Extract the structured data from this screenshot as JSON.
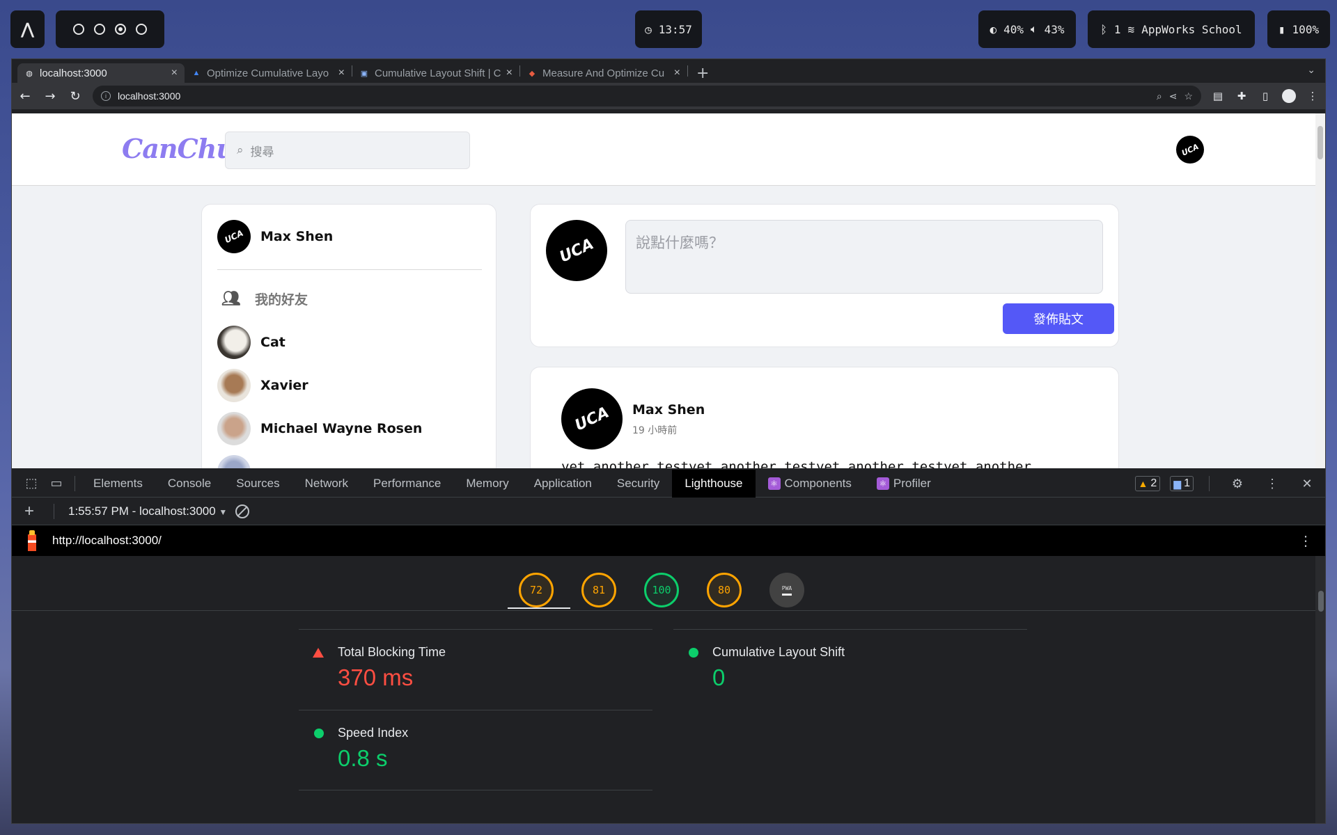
{
  "topbar": {
    "clock": "13:57",
    "brightness": "40%",
    "volume": "43%",
    "bluetooth_count": "1",
    "wifi_name": "AppWorks School",
    "battery": "100%"
  },
  "browser": {
    "tabs": [
      {
        "title": "localhost:3000",
        "icon": "globe-icon",
        "active": true
      },
      {
        "title": "Optimize Cumulative Layo",
        "icon": "web-dev-icon",
        "active": false
      },
      {
        "title": "Cumulative Layout Shift | C",
        "icon": "chrome-devs-icon",
        "active": false
      },
      {
        "title": "Measure And Optimize Cu",
        "icon": "smashing-icon",
        "active": false
      }
    ],
    "address": "localhost:3000"
  },
  "page": {
    "logo": "CanChu",
    "search_placeholder": "搜尋",
    "me_name": "Max Shen",
    "friends_title": "我的好友",
    "friends": [
      {
        "name": "Cat"
      },
      {
        "name": "Xavier"
      },
      {
        "name": "Michael Wayne Rosen"
      }
    ],
    "composer_placeholder": "說點什麼嗎？",
    "post_button": "發佈貼文",
    "post": {
      "author": "Max Shen",
      "time": "19 小時前",
      "body": "yet another testyet another testyet another testyet another"
    }
  },
  "devtools": {
    "tabs": [
      "Elements",
      "Console",
      "Sources",
      "Network",
      "Performance",
      "Memory",
      "Application",
      "Security",
      "Lighthouse",
      "Components",
      "Profiler"
    ],
    "active_tab": "Lighthouse",
    "warnings": "2",
    "messages": "1",
    "report_selector": "1:55:57 PM - localhost:3000",
    "lighthouse_url": "http://localhost:3000/",
    "scores": [
      {
        "value": "72",
        "status": "average"
      },
      {
        "value": "81",
        "status": "average"
      },
      {
        "value": "100",
        "status": "pass"
      },
      {
        "value": "80",
        "status": "average"
      }
    ],
    "pwa_label": "PWA",
    "metrics": [
      {
        "label": "Total Blocking Time",
        "value": "370 ms",
        "status": "fail"
      },
      {
        "label": "Cumulative Layout Shift",
        "value": "0",
        "status": "pass"
      },
      {
        "label": "Speed Index",
        "value": "0.8 s",
        "status": "pass"
      }
    ]
  }
}
